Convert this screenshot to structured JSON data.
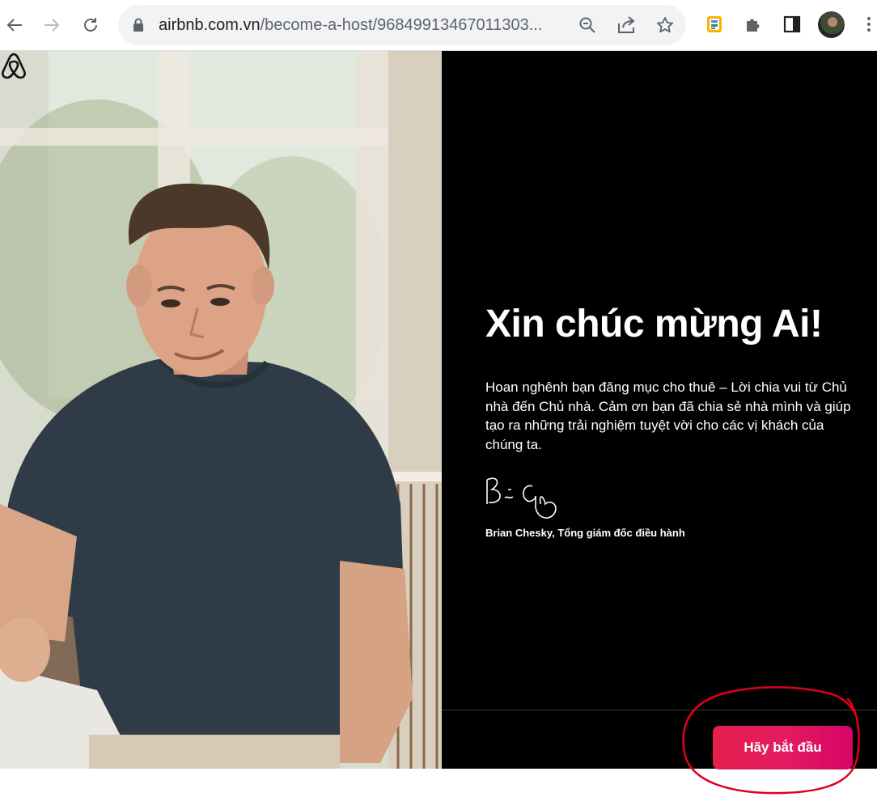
{
  "browser": {
    "url_host": "airbnb.com.vn",
    "url_path": "/become-a-host/96849913467011303..."
  },
  "welcome": {
    "headline": "Xin chúc mừng Ai!",
    "message": "Hoan nghênh bạn đăng mục cho thuê – Lời chia vui từ Chủ nhà đến Chủ nhà. Cảm ơn bạn đã chia sẻ nhà mình và giúp tạo ra những trải nghiệm tuyệt vời cho các vị khách của chúng ta.",
    "signer": "Brian Chesky, Tổng giám đốc điều hành"
  },
  "cta": {
    "label": "Hãy bắt đầu"
  },
  "colors": {
    "brand": "#E61E4D",
    "brand_end": "#D70466",
    "annotation": "#E0001B"
  },
  "icons": [
    "back-arrow-icon",
    "forward-arrow-icon",
    "reload-icon",
    "lock-icon",
    "zoom-icon",
    "share-icon",
    "star-icon",
    "extension-icon",
    "puzzle-icon",
    "side-panel-icon",
    "more-icon",
    "airbnb-logo"
  ]
}
